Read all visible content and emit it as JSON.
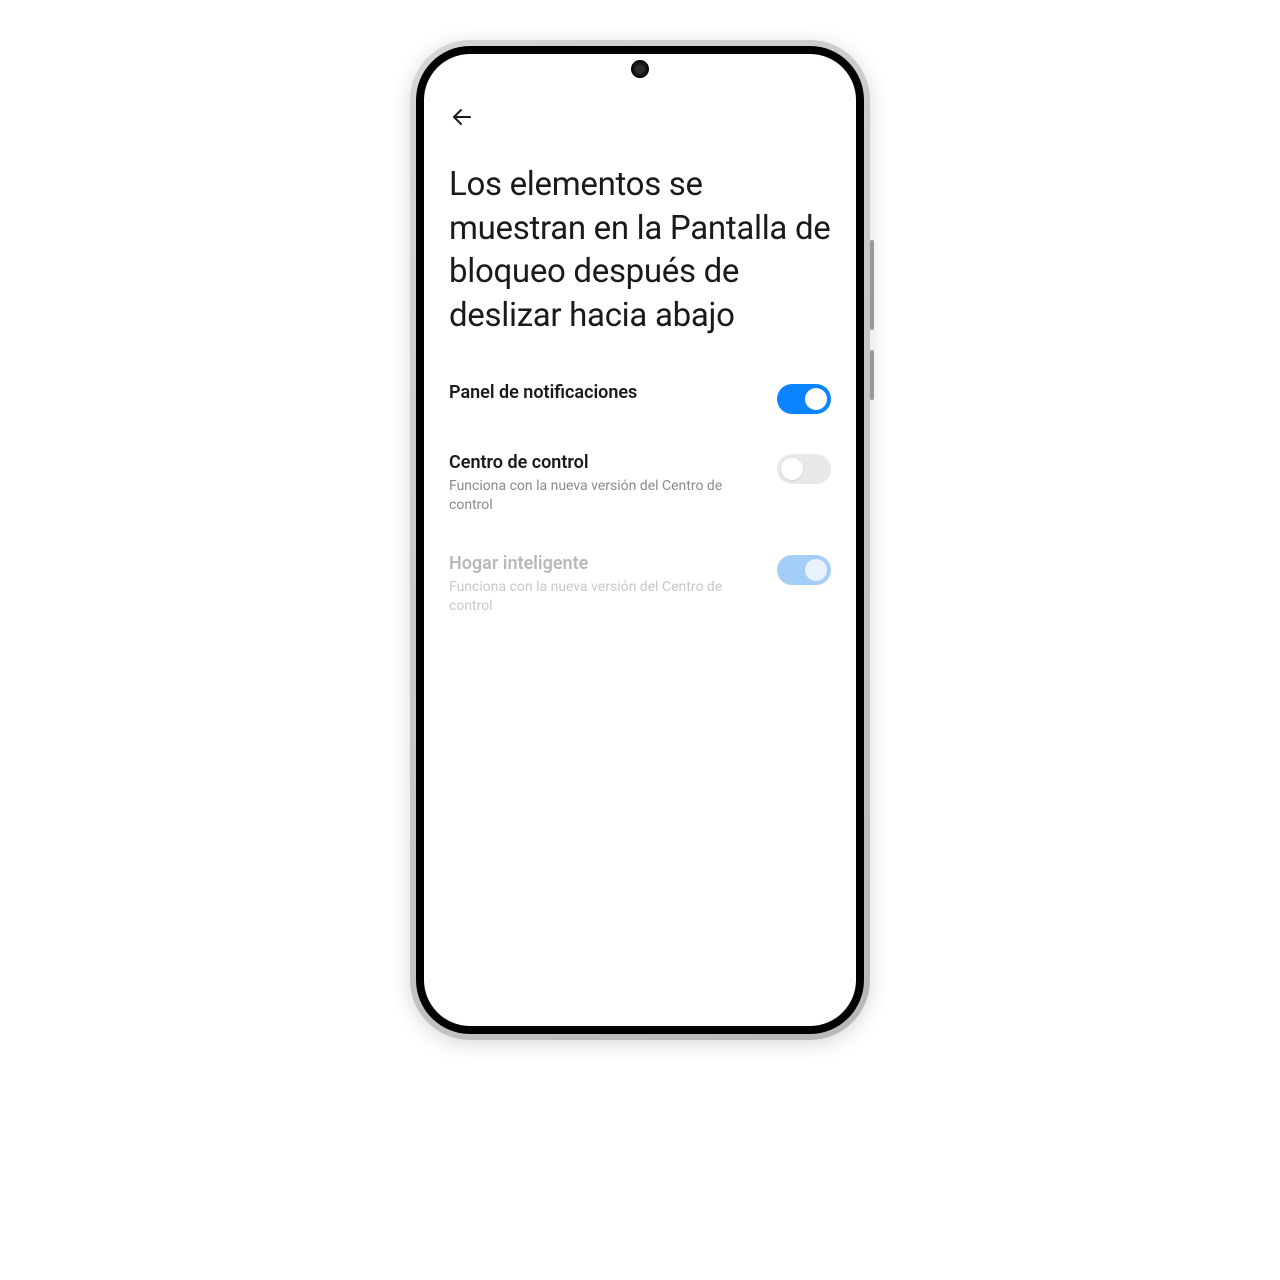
{
  "header": {
    "title": "Los elementos se muestran en la Pantalla de bloqueo después de deslizar hacia abajo"
  },
  "settings": [
    {
      "title": "Panel de notificaciones",
      "desc": "",
      "toggle": "on",
      "disabled": false
    },
    {
      "title": "Centro de control",
      "desc": "Funciona con la nueva versión del Centro de control",
      "toggle": "off",
      "disabled": false
    },
    {
      "title": "Hogar inteligente",
      "desc": "Funciona con la nueva versión del Centro de control",
      "toggle": "on",
      "disabled": true
    }
  ],
  "colors": {
    "accent": "#0a84ff"
  }
}
